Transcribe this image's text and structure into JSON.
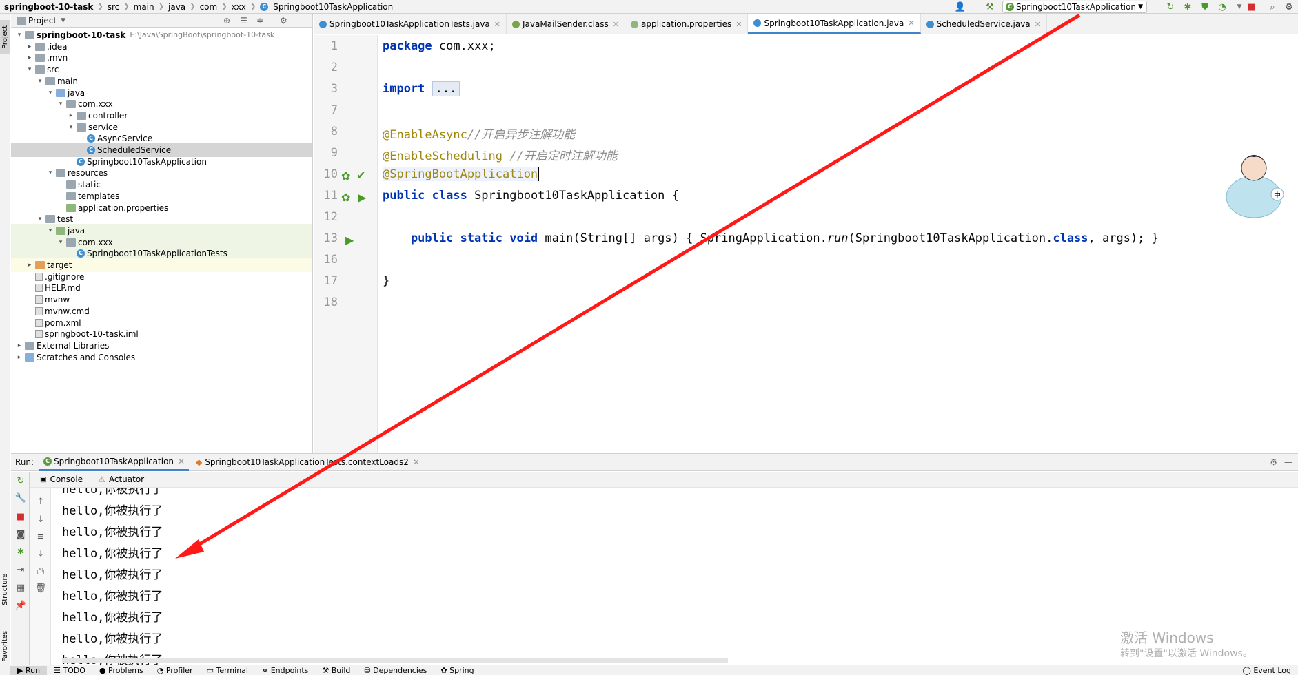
{
  "breadcrumb": {
    "project": "springboot-10-task",
    "parts": [
      "src",
      "main",
      "java",
      "com",
      "xxx"
    ],
    "file": "Springboot10TaskApplication"
  },
  "run_config": {
    "selected": "Springboot10TaskApplication"
  },
  "left_stripe": {
    "project": "Project",
    "structure": "Structure",
    "favorites": "Favorites"
  },
  "project_panel": {
    "title": "Project",
    "tree": [
      {
        "label": "springboot-10-task",
        "hint": "E:\\Java\\SpringBoot\\springboot-10-task",
        "icon": "folder-icon"
      },
      {
        "label": ".idea",
        "icon": "folder-icon"
      },
      {
        "label": ".mvn",
        "icon": "folder-icon"
      },
      {
        "label": "src",
        "icon": "folder-icon"
      },
      {
        "label": "main",
        "icon": "folder-icon"
      },
      {
        "label": "java",
        "icon": "source-folder-icon"
      },
      {
        "label": "com.xxx",
        "icon": "package-icon"
      },
      {
        "label": "controller",
        "icon": "package-icon"
      },
      {
        "label": "service",
        "icon": "package-icon"
      },
      {
        "label": "AsyncService",
        "icon": "class-icon"
      },
      {
        "label": "ScheduledService",
        "icon": "class-icon"
      },
      {
        "label": "Springboot10TaskApplication",
        "icon": "spring-class-icon"
      },
      {
        "label": "resources",
        "icon": "resources-folder-icon"
      },
      {
        "label": "static",
        "icon": "folder-icon"
      },
      {
        "label": "templates",
        "icon": "folder-icon"
      },
      {
        "label": "application.properties",
        "icon": "properties-icon"
      },
      {
        "label": "test",
        "icon": "folder-icon"
      },
      {
        "label": "java",
        "icon": "test-folder-icon"
      },
      {
        "label": "com.xxx",
        "icon": "package-icon"
      },
      {
        "label": "Springboot10TaskApplicationTests",
        "icon": "class-icon"
      },
      {
        "label": "target",
        "icon": "excluded-folder-icon"
      },
      {
        "label": ".gitignore",
        "icon": "file-icon"
      },
      {
        "label": "HELP.md",
        "icon": "markdown-icon"
      },
      {
        "label": "mvnw",
        "icon": "file-icon"
      },
      {
        "label": "mvnw.cmd",
        "icon": "file-icon"
      },
      {
        "label": "pom.xml",
        "icon": "maven-icon"
      },
      {
        "label": "springboot-10-task.iml",
        "icon": "module-icon"
      },
      {
        "label": "External Libraries",
        "icon": "library-icon"
      },
      {
        "label": "Scratches and Consoles",
        "icon": "scratches-icon"
      }
    ]
  },
  "tabs": [
    {
      "label": "Springboot10TaskApplicationTests.java",
      "color": "#3d8fd1"
    },
    {
      "label": "JavaMailSender.class",
      "color": "#78a44c"
    },
    {
      "label": "application.properties",
      "color": "#8fb77b"
    },
    {
      "label": "Springboot10TaskApplication.java",
      "color": "#3d8fd1"
    },
    {
      "label": "ScheduledService.java",
      "color": "#3d8fd1"
    }
  ],
  "editor": {
    "line_numbers": [
      "1",
      "2",
      "3",
      "7",
      "8",
      "9",
      "10",
      "11",
      "12",
      "13",
      "16",
      "17",
      "18"
    ],
    "code": {
      "l1_kw": "package",
      "l1_rest": " com.xxx;",
      "l3_kw": "import",
      "l3_fold": "...",
      "l8_ann": "@EnableAsync",
      "l8_cmt": "//开启异步注解功能",
      "l9_ann": "@EnableScheduling",
      "l9_cmt": " //开启定时注解功能",
      "l10_ann": "@SpringBootApplication",
      "l11_kw": "public class",
      "l11_rest": " Springboot10TaskApplication {",
      "l13_kw": "    public static void",
      "l13_a": " main(String[] args) { SpringApplication.",
      "l13_meth": "run",
      "l13_b": "(Springboot10TaskApplication.",
      "l13_kw2": "class",
      "l13_c": ", args); }",
      "l17": "}"
    }
  },
  "run_panel": {
    "label": "Run:",
    "tabs": [
      "Springboot10TaskApplication",
      "Springboot10TaskApplicationTests.contextLoads2"
    ],
    "subtabs": [
      "Console",
      "Actuator"
    ],
    "console_lines": [
      "hello,你被执行了",
      "hello,你被执行了",
      "hello,你被执行了",
      "hello,你被执行了",
      "hello,你被执行了",
      "hello,你被执行了",
      "hello,你被执行了",
      "hello,你被执行了",
      "hello,你被执行了"
    ]
  },
  "bottom_bar": {
    "items": [
      "Run",
      "TODO",
      "Problems",
      "Profiler",
      "Terminal",
      "Endpoints",
      "Build",
      "Dependencies",
      "Spring"
    ],
    "event_log": "Event Log"
  },
  "watermark": {
    "line1": "激活 Windows",
    "line2": "转到\"设置\"以激活 Windows。"
  },
  "colors": {
    "accent": "#4083c9",
    "arrow": "#ff1a1a",
    "selected_row": "#d5d5d5"
  }
}
